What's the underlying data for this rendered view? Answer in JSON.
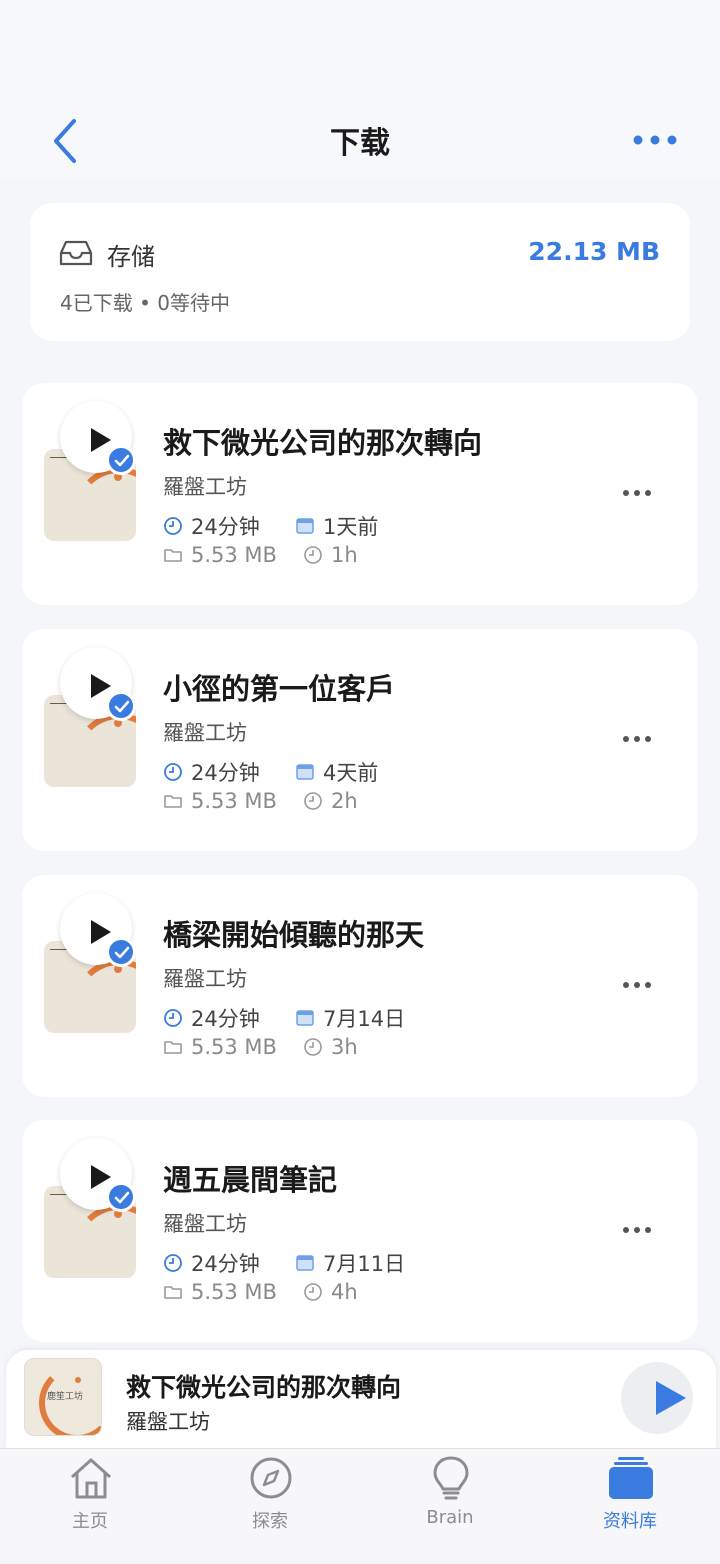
{
  "header": {
    "title": "下载"
  },
  "storage": {
    "label": "存储",
    "size": "22.13 MB",
    "summary": "4已下载 • 0等待中"
  },
  "episodes": [
    {
      "title": "救下微光公司的那次轉向",
      "author": "羅盤工坊",
      "duration": "24分钟",
      "date": "1天前",
      "size": "5.53 MB",
      "elapsed": "1h"
    },
    {
      "title": "小徑的第一位客戶",
      "author": "羅盤工坊",
      "duration": "24分钟",
      "date": "4天前",
      "size": "5.53 MB",
      "elapsed": "2h"
    },
    {
      "title": "橋梁開始傾聽的那天",
      "author": "羅盤工坊",
      "duration": "24分钟",
      "date": "7月14日",
      "size": "5.53 MB",
      "elapsed": "3h"
    },
    {
      "title": "週五晨間筆記",
      "author": "羅盤工坊",
      "duration": "24分钟",
      "date": "7月11日",
      "size": "5.53 MB",
      "elapsed": "4h"
    }
  ],
  "player": {
    "title": "救下微光公司的那次轉向",
    "author": "羅盤工坊",
    "cover_text": "鹿笙工坊"
  },
  "tabs": [
    {
      "label": "主页",
      "icon": "home-icon"
    },
    {
      "label": "探索",
      "icon": "compass-icon"
    },
    {
      "label": "Brain",
      "icon": "lightbulb-icon"
    },
    {
      "label": "资料库",
      "icon": "library-icon"
    }
  ],
  "colors": {
    "accent": "#3a7be0",
    "thumb_orange": "#e07c3e"
  }
}
